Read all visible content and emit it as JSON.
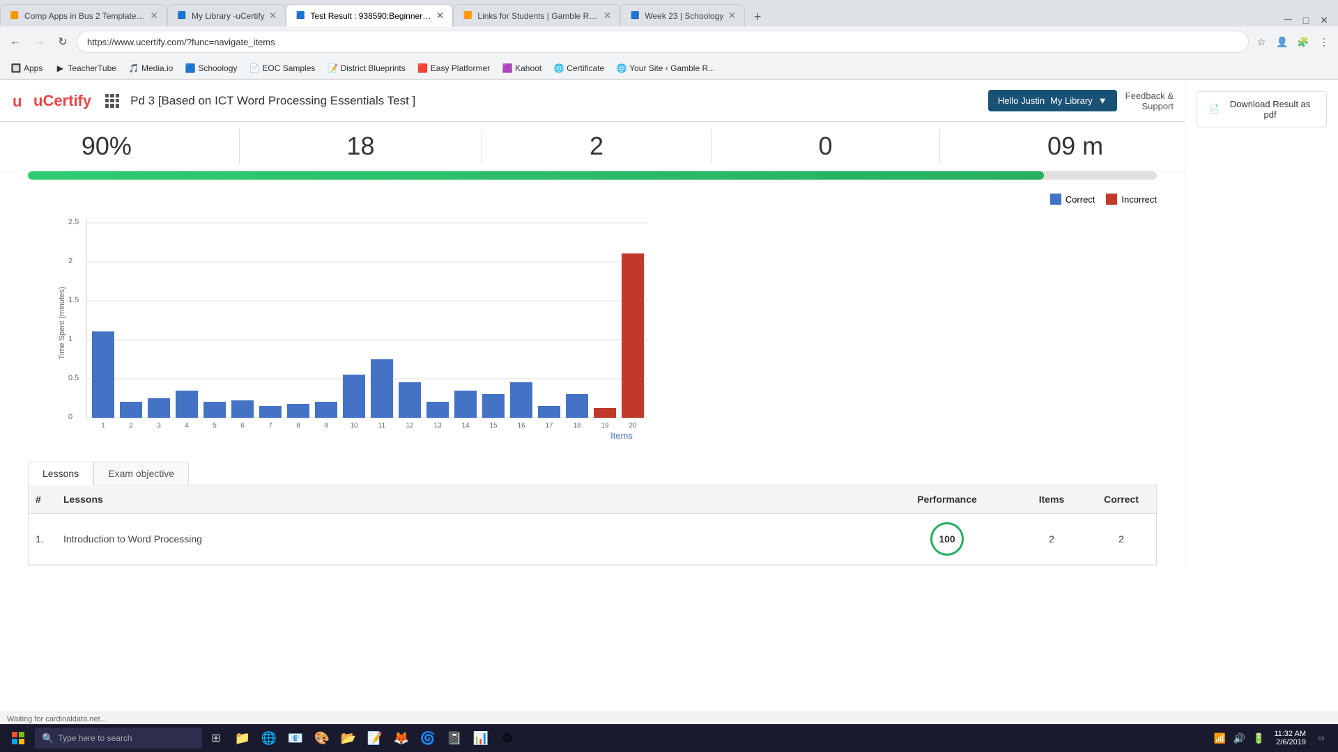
{
  "browser": {
    "tabs": [
      {
        "id": 1,
        "title": "Comp Apps in Bus 2 Template -...",
        "favicon": "🟧",
        "active": false
      },
      {
        "id": 2,
        "title": "My Library -uCertify",
        "favicon": "🟦",
        "active": false
      },
      {
        "id": 3,
        "title": "Test Result : 938590:Beginner -u...",
        "favicon": "🟦",
        "active": true
      },
      {
        "id": 4,
        "title": "Links for Students | Gamble Roo...",
        "favicon": "🟧",
        "active": false
      },
      {
        "id": 5,
        "title": "Week 23 | Schoology",
        "favicon": "🟦",
        "active": false
      }
    ],
    "url": "https://www.ucertify.com/?func=navigate_items",
    "new_tab_label": "+"
  },
  "bookmarks": [
    {
      "label": "Apps",
      "favicon": "🔲"
    },
    {
      "label": "TeacherTube",
      "favicon": "▶"
    },
    {
      "label": "Media.io",
      "favicon": "🎵"
    },
    {
      "label": "Schoology",
      "favicon": "🟦"
    },
    {
      "label": "EOC Samples",
      "favicon": "📄"
    },
    {
      "label": "District Blueprints",
      "favicon": "📝"
    },
    {
      "label": "Easy Platformer",
      "favicon": "🟥"
    },
    {
      "label": "Kahoot",
      "favicon": "🟪"
    },
    {
      "label": "Certificate",
      "favicon": "🌐"
    },
    {
      "label": "Your Site ‹ Gamble R...",
      "favicon": "🌐"
    }
  ],
  "header": {
    "logo_text": "uCertify",
    "page_title": "Pd 3 [Based on ICT Word Processing Essentials Test ]",
    "hello_label": "Hello Justin",
    "my_library_label": "My Library",
    "feedback_label": "Feedback &",
    "support_label": "Support"
  },
  "stats": {
    "score": "90%",
    "correct": "18",
    "incorrect": "2",
    "skipped": "0",
    "time": "09 m",
    "progress_percent": 90
  },
  "chart": {
    "title": "Items",
    "y_label": "Time Spent (minutes)",
    "legend": {
      "correct_label": "Correct",
      "incorrect_label": "Incorrect",
      "correct_color": "#4472c4",
      "incorrect_color": "#c0392b"
    },
    "y_ticks": [
      "2.5",
      "2",
      "1.5",
      "1",
      "0.5",
      "0"
    ],
    "bars": [
      {
        "item": "1",
        "value": 1.1,
        "correct": true
      },
      {
        "item": "2",
        "value": 0.2,
        "correct": true
      },
      {
        "item": "3",
        "value": 0.25,
        "correct": true
      },
      {
        "item": "4",
        "value": 0.35,
        "correct": true
      },
      {
        "item": "5",
        "value": 0.2,
        "correct": true
      },
      {
        "item": "6",
        "value": 0.22,
        "correct": true
      },
      {
        "item": "7",
        "value": 0.15,
        "correct": true
      },
      {
        "item": "8",
        "value": 0.18,
        "correct": true
      },
      {
        "item": "9",
        "value": 0.2,
        "correct": true
      },
      {
        "item": "10",
        "value": 0.55,
        "correct": true
      },
      {
        "item": "11",
        "value": 0.75,
        "correct": true
      },
      {
        "item": "12",
        "value": 0.45,
        "correct": true
      },
      {
        "item": "13",
        "value": 0.2,
        "correct": true
      },
      {
        "item": "14",
        "value": 0.35,
        "correct": true
      },
      {
        "item": "15",
        "value": 0.3,
        "correct": true
      },
      {
        "item": "16",
        "value": 0.45,
        "correct": true
      },
      {
        "item": "17",
        "value": 0.15,
        "correct": true
      },
      {
        "item": "18",
        "value": 0.3,
        "correct": true
      },
      {
        "item": "19",
        "value": 0.12,
        "correct": false
      },
      {
        "item": "20",
        "value": 2.1,
        "correct": false
      }
    ]
  },
  "tabs": {
    "lessons_label": "Lessons",
    "exam_label": "Exam objective",
    "active": "lessons"
  },
  "table": {
    "headers": [
      "#",
      "Lessons",
      "Performance",
      "Items",
      "Correct"
    ],
    "rows": [
      {
        "num": "1.",
        "lesson": "Introduction to Word Processing",
        "performance": 100,
        "items": 2,
        "correct": 2
      }
    ]
  },
  "sidebar": {
    "download_label": "Download Result as pdf"
  },
  "statusbar": {
    "text": "Waiting for cardinaldata.net..."
  },
  "taskbar": {
    "search_placeholder": "Type here to search",
    "time": "11:32 AM",
    "date": "2/6/2019",
    "show_desktop": "▭"
  }
}
